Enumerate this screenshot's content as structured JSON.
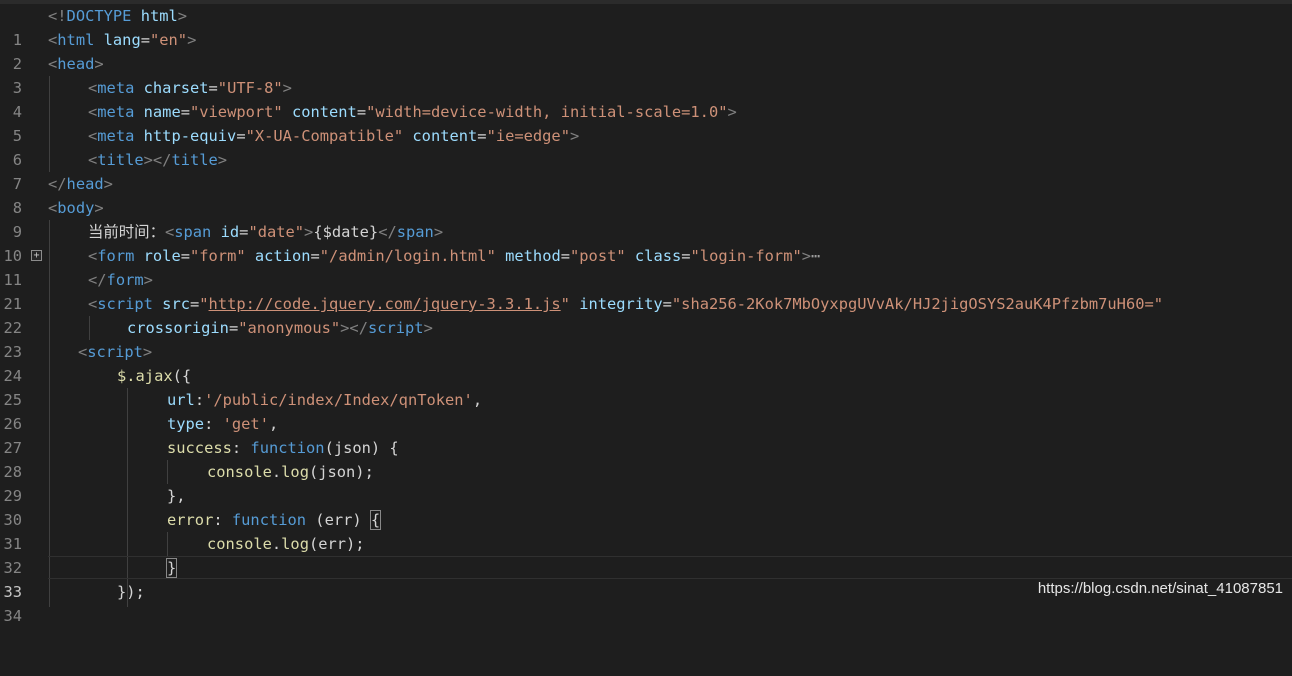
{
  "editor": {
    "theme_colors": {
      "background": "#1e1e1e",
      "tag": "#569cd6",
      "attribute": "#9cdcfe",
      "string": "#ce9178",
      "function": "#dcdcaa",
      "text": "#d4d4d4"
    },
    "current_line": "33",
    "fold_icon": "plus-box-icon",
    "lines": {
      "l1": {
        "num": "1",
        "t1": "<!",
        "doctype": "DOCTYPE",
        "sp": " ",
        "html": "html",
        "t2": ">"
      },
      "l2": {
        "num": "2",
        "open": "<",
        "tag": "html",
        "sp": " ",
        "attr": "lang",
        "eq": "=",
        "val": "\"en\"",
        "close": ">"
      },
      "l3": {
        "num": "3",
        "open": "<",
        "tag": "head",
        "close": ">"
      },
      "l4": {
        "num": "4",
        "open": "<",
        "tag": "meta",
        "sp": " ",
        "attr": "charset",
        "eq": "=",
        "val": "\"UTF-8\"",
        "close": ">"
      },
      "l5": {
        "num": "5",
        "open": "<",
        "tag": "meta",
        "sp1": " ",
        "attr1": "name",
        "eq1": "=",
        "val1": "\"viewport\"",
        "sp2": " ",
        "attr2": "content",
        "eq2": "=",
        "val2": "\"width=device-width, initial-scale=1.0\"",
        "close": ">"
      },
      "l6": {
        "num": "6",
        "open": "<",
        "tag": "meta",
        "sp1": " ",
        "attr1": "http-equiv",
        "eq1": "=",
        "val1": "\"X-UA-Compatible\"",
        "sp2": " ",
        "attr2": "content",
        "eq2": "=",
        "val2": "\"ie=edge\"",
        "close": ">"
      },
      "l7": {
        "num": "7",
        "open": "<",
        "tag": "title",
        "mid": "></",
        "tag2": "title",
        "close": ">"
      },
      "l8": {
        "num": "8",
        "open": "</",
        "tag": "head",
        "close": ">"
      },
      "l9": {
        "num": "9",
        "open": "<",
        "tag": "body",
        "close": ">"
      },
      "l10": {
        "num": "10",
        "text": "当前时间：",
        "open": "<",
        "tag": "span",
        "sp": " ",
        "attr": "id",
        "eq": "=",
        "val": "\"date\"",
        "close": ">",
        "content": "{$date}",
        "open2": "</",
        "tag2": "span",
        "close2": ">"
      },
      "l11": {
        "num": "11",
        "open": "<",
        "tag": "form",
        "sp1": " ",
        "attr1": "role",
        "eq1": "=",
        "val1": "\"form\"",
        "sp2": " ",
        "attr2": "action",
        "eq2": "=",
        "val2": "\"/admin/login.html\"",
        "sp3": " ",
        "attr3": "method",
        "eq3": "=",
        "val3": "\"post\"",
        "sp4": " ",
        "attr4": "class",
        "eq4": "=",
        "val4": "\"login-form\"",
        "close": ">",
        "ellipsis": "⋯"
      },
      "l21": {
        "num": "21",
        "open": "</",
        "tag": "form",
        "close": ">"
      },
      "l22": {
        "num": "22",
        "open": "<",
        "tag": "script",
        "sp1": " ",
        "attr1": "src",
        "eq1": "=",
        "q1": "\"",
        "url": "http://code.jquery.com/jquery-3.3.1.js",
        "q2": "\"",
        "sp2": " ",
        "attr2": "integrity",
        "eq2": "=",
        "val2": "\"sha256-2Kok7MbOyxpgUVvAk/HJ2jigOSYS2auK4Pfzbm7uH60=\""
      },
      "l23": {
        "num": "23",
        "attr": "crossorigin",
        "eq": "=",
        "val": "\"anonymous\"",
        "mid": "></",
        "tag": "script",
        "close": ">"
      },
      "l24": {
        "num": "24",
        "open": "<",
        "tag": "script",
        "close": ">"
      },
      "l25": {
        "num": "25",
        "fn": "$.ajax",
        "rest": "({"
      },
      "l26": {
        "num": "26",
        "key": "url",
        "colon": ":",
        "val": "'/public/index/Index/qnToken'",
        "comma": ","
      },
      "l27": {
        "num": "27",
        "key": "type",
        "colon": ": ",
        "val": "'get'",
        "comma": ","
      },
      "l28": {
        "num": "28",
        "key": "success",
        "colon": ": ",
        "kw": "function",
        "rest": "(json) {"
      },
      "l29": {
        "num": "29",
        "obj": "console",
        "dot": ".",
        "fn": "log",
        "rest": "(json);"
      },
      "l30": {
        "num": "30",
        "text": "},"
      },
      "l31": {
        "num": "31",
        "key": "error",
        "colon": ": ",
        "kw": "function",
        "rest": " (err) ",
        "brace": "{"
      },
      "l32": {
        "num": "32",
        "obj": "console",
        "dot": ".",
        "fn": "log",
        "rest": "(err);"
      },
      "l33": {
        "num": "33",
        "brace": "}"
      },
      "l34": {
        "num": "34",
        "text": "});"
      }
    }
  },
  "watermark": "https://blog.csdn.net/sinat_41087851"
}
